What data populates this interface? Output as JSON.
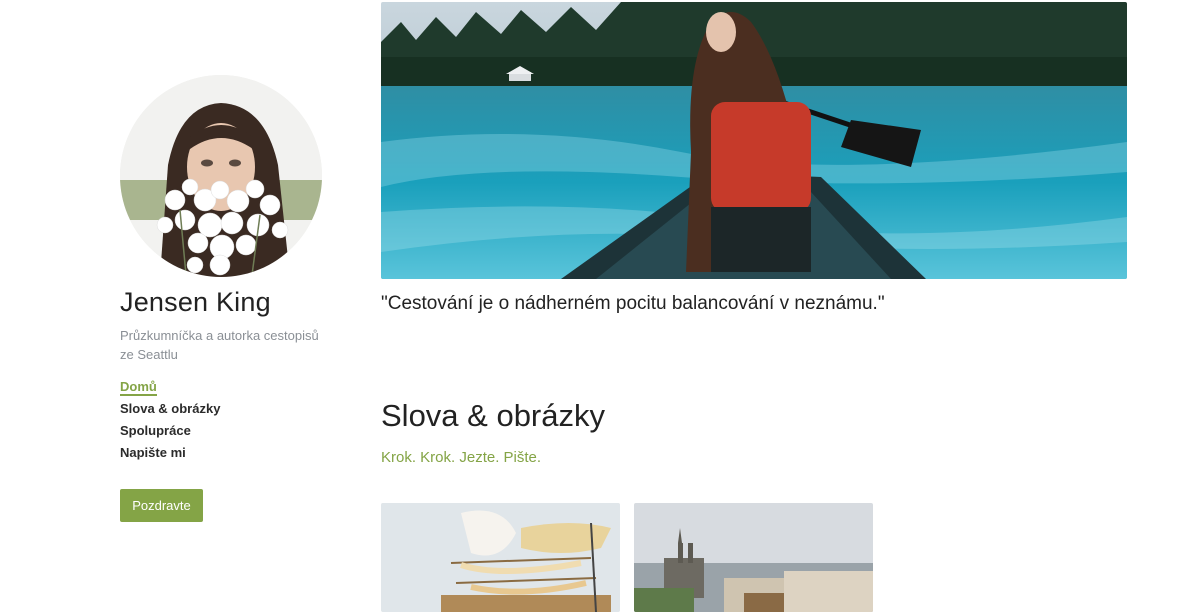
{
  "profile": {
    "name": "Jensen King",
    "tagline": "Průzkumníčka a autorka cestopisů ze Seattlu"
  },
  "nav": {
    "items": [
      {
        "label": "Domů",
        "active": true
      },
      {
        "label": "Slova & obrázky",
        "active": false
      },
      {
        "label": "Spolupráce",
        "active": false
      },
      {
        "label": "Napište mi",
        "active": false
      }
    ]
  },
  "cta": {
    "label": "Pozdravte"
  },
  "hero": {
    "quote": "\"Cestování je o nádherném pocitu balancování v neznámu.\""
  },
  "section": {
    "title": "Slova & obrázky",
    "subtitle": "Krok. Krok. Jezte. Pište."
  },
  "theme": {
    "accent": "#84a446",
    "text": "#222222",
    "muted": "#8a8f95"
  }
}
